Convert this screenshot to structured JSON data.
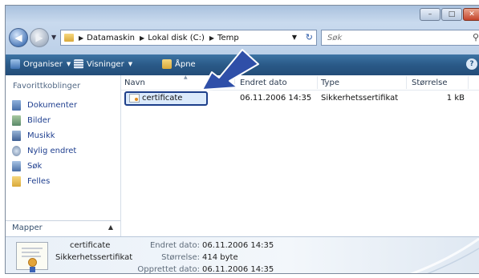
{
  "address": {
    "crumbs": [
      "Datamaskin",
      "Lokal disk (C:)",
      "Temp"
    ]
  },
  "search": {
    "placeholder": "Søk"
  },
  "toolbar": {
    "organize": "Organiser",
    "views": "Visninger",
    "open": "Åpne"
  },
  "navpane": {
    "heading": "Favorittkoblinger",
    "links": [
      "Dokumenter",
      "Bilder",
      "Musikk",
      "Nylig endret",
      "Søk",
      "Felles"
    ],
    "folders_label": "Mapper"
  },
  "columns": [
    "Navn",
    "Endret dato",
    "Type",
    "Størrelse"
  ],
  "files": [
    {
      "name": "certificate",
      "modified": "06.11.2006 14:35",
      "type": "Sikkerhetssertifikat",
      "size": "1 kB"
    }
  ],
  "details": {
    "name": "certificate",
    "type": "Sikkerhetssertifikat",
    "modified_label": "Endret dato:",
    "modified_value": "06.11.2006 14:35",
    "size_label": "Størrelse:",
    "size_value": "414 byte",
    "created_label": "Opprettet dato:",
    "created_value": "06.11.2006 14:35"
  },
  "colors": {
    "toolbar": "#2a5a88",
    "link": "#1f3f8f",
    "arrow": "#2f4fa8",
    "selection_border": "#1d3f8a"
  }
}
